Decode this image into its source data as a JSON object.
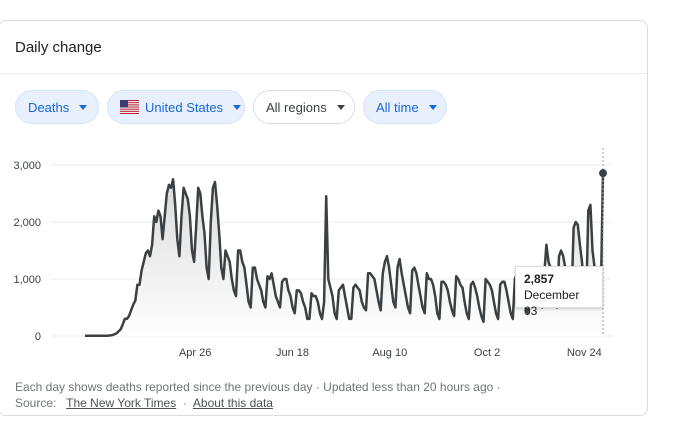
{
  "card": {
    "title": "Daily change"
  },
  "filters": [
    {
      "label": "Deaths",
      "style": "filled",
      "selected": true
    },
    {
      "label": "United States",
      "style": "filled",
      "selected": true,
      "icon": "us-flag-icon"
    },
    {
      "label": "All regions",
      "style": "outline",
      "selected": false
    },
    {
      "label": "All time",
      "style": "filled",
      "selected": true
    }
  ],
  "colors": {
    "line": "#3c4043",
    "area_top": "#d9d9d9",
    "accent_chip_text": "#1967d2",
    "gridline": "#ebebeb"
  },
  "tooltip": {
    "value": "2,857",
    "date": "December 03"
  },
  "footer": {
    "line1": "Each day shows deaths reported since the previous day · Updated less than 20 hours ago  ·",
    "source_label": "Source:",
    "source_link": "The New York Times",
    "separator": "·",
    "about_link": "About this data"
  },
  "chart_data": {
    "type": "area",
    "title": "",
    "xlabel": "",
    "ylabel": "",
    "ylim": [
      0,
      3000
    ],
    "yticks": [
      0,
      1000,
      2000,
      3000
    ],
    "ytick_labels": [
      "0",
      "1,000",
      "2,000",
      "3,000"
    ],
    "xtick_labels": [
      "Apr 26",
      "Jun 18",
      "Aug 10",
      "Oct 2",
      "Nov 24"
    ],
    "grid": true,
    "x_start": "Mar 01",
    "x_end": "December 03",
    "values": [
      5,
      5,
      5,
      5,
      5,
      5,
      5,
      5,
      5,
      5,
      5,
      5,
      10,
      15,
      30,
      45,
      80,
      120,
      200,
      300,
      300,
      350,
      450,
      550,
      620,
      900,
      900,
      1150,
      1300,
      1450,
      1500,
      1400,
      1600,
      2100,
      2000,
      2200,
      2100,
      1700,
      2100,
      2500,
      2650,
      2600,
      2750,
      2300,
      1700,
      1400,
      2100,
      2600,
      2500,
      2400,
      2100,
      1500,
      1300,
      1900,
      2600,
      2500,
      2100,
      1800,
      1200,
      1000,
      2000,
      2600,
      2700,
      2300,
      1800,
      1200,
      1000,
      1500,
      1400,
      1300,
      1000,
      800,
      700,
      1500,
      1500,
      1300,
      1200,
      900,
      600,
      500,
      1200,
      1200,
      1000,
      900,
      800,
      600,
      500,
      1050,
      1000,
      1100,
      900,
      700,
      600,
      500,
      950,
      1000,
      1000,
      800,
      700,
      500,
      400,
      800,
      800,
      750,
      600,
      500,
      300,
      300,
      750,
      700,
      700,
      600,
      400,
      300,
      600,
      2450,
      1000,
      850,
      700,
      400,
      300,
      800,
      850,
      900,
      700,
      500,
      300,
      300,
      850,
      900,
      850,
      800,
      600,
      500,
      450,
      1100,
      1100,
      1050,
      1000,
      800,
      600,
      450,
      1100,
      1300,
      1400,
      1200,
      900,
      600,
      500,
      1200,
      1350,
      1100,
      900,
      700,
      500,
      400,
      1150,
      1200,
      1100,
      900,
      700,
      500,
      400,
      1100,
      1000,
      1000,
      900,
      700,
      400,
      300,
      950,
      950,
      900,
      800,
      600,
      450,
      350,
      1050,
      1000,
      900,
      850,
      600,
      400,
      300,
      900,
      950,
      850,
      700,
      500,
      350,
      250,
      1000,
      950,
      900,
      800,
      600,
      400,
      300,
      900,
      950,
      950,
      800,
      600,
      400,
      300,
      1000,
      1100,
      1050,
      900,
      700,
      500,
      400,
      800,
      1150,
      1200,
      1000,
      900,
      600,
      500,
      1100,
      1600,
      1300,
      1200,
      900,
      700,
      500,
      1400,
      1500,
      1400,
      1200,
      900,
      700,
      600,
      1900,
      2000,
      1950,
      1600,
      1300,
      800,
      600,
      2200,
      2300,
      1500,
      1200,
      1000,
      700,
      800,
      2857
    ]
  }
}
